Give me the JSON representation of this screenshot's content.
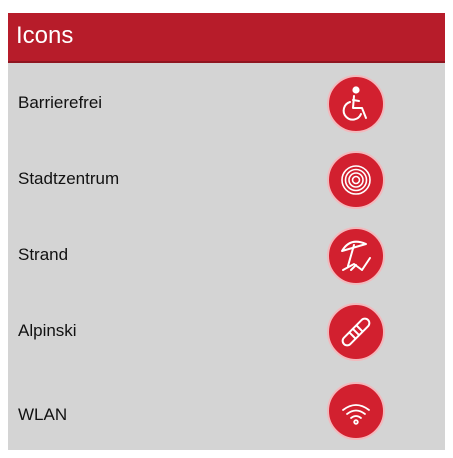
{
  "header": {
    "title": "Icons"
  },
  "items": [
    {
      "label": "Barrierefrei",
      "icon": "wheelchair-icon"
    },
    {
      "label": "Stadtzentrum",
      "icon": "target-icon"
    },
    {
      "label": "Strand",
      "icon": "beach-umbrella-icon"
    },
    {
      "label": "Alpinski",
      "icon": "ski-icon"
    },
    {
      "label": "WLAN",
      "icon": "wifi-icon"
    }
  ],
  "colors": {
    "brand_red": "#b71c2a",
    "icon_red": "#d2202f",
    "panel_gray": "#d4d4d4",
    "icon_line": "#ffffff"
  }
}
